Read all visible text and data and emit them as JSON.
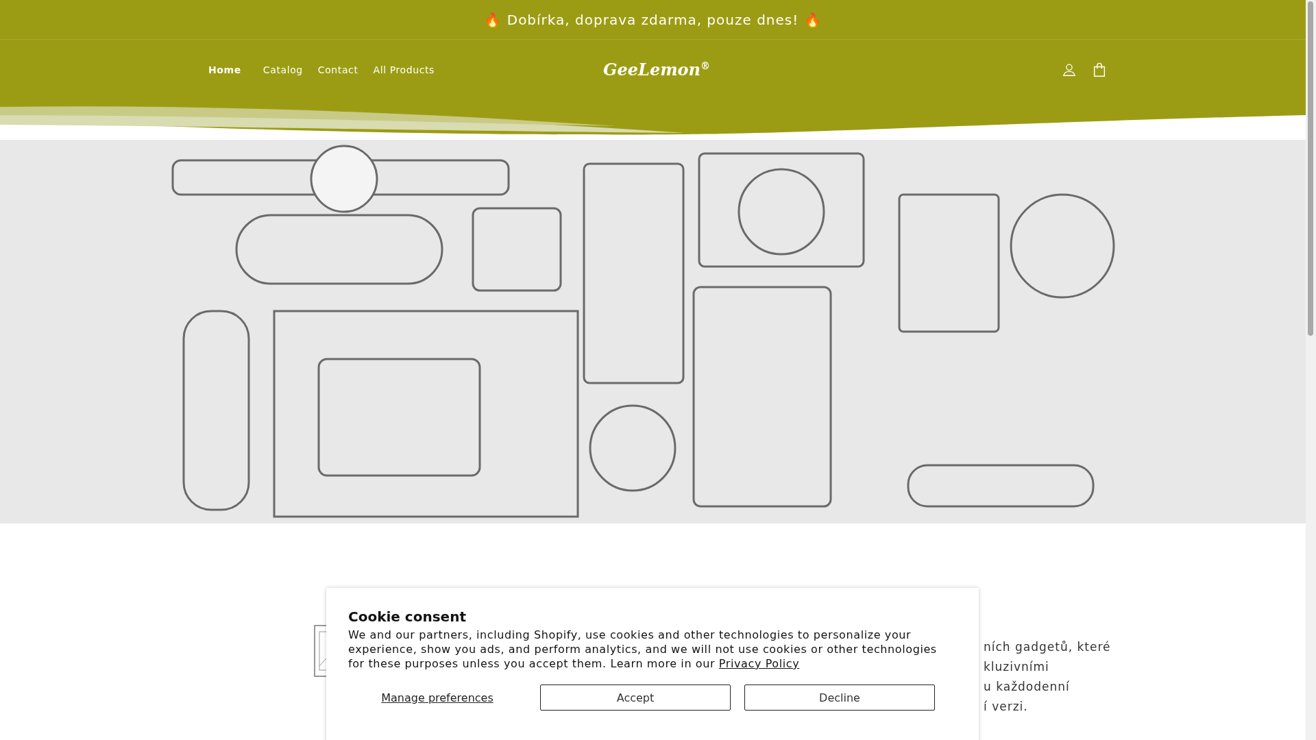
{
  "announcement": {
    "icon": "🔥",
    "text": "Dobírka, doprava zdarma, pouze dnes!",
    "icon_end": "🔥"
  },
  "nav": {
    "items": [
      {
        "label": "Home",
        "selected": true
      },
      {
        "label": "Catalog",
        "selected": false
      },
      {
        "label": "Contact",
        "selected": false
      },
      {
        "label": "All Products",
        "selected": false
      }
    ],
    "logo": "GeeLemon",
    "logo_mark": "®"
  },
  "about_text_lines": [
    "ních gadgetů, které",
    "kluzivními",
    "u každodenní",
    "í verzi."
  ],
  "cookie_banner": {
    "title": "Cookie consent",
    "body": "We and our partners, including Shopify, use cookies and other technologies to personalize your experience, show you ads, and perform analytics, and we will not use cookies or other technologies for these purposes unless you accept them. Learn more in our",
    "link": "Privacy Policy",
    "manage": "Manage preferences",
    "buttons": [
      "Accept",
      "Decline"
    ]
  }
}
